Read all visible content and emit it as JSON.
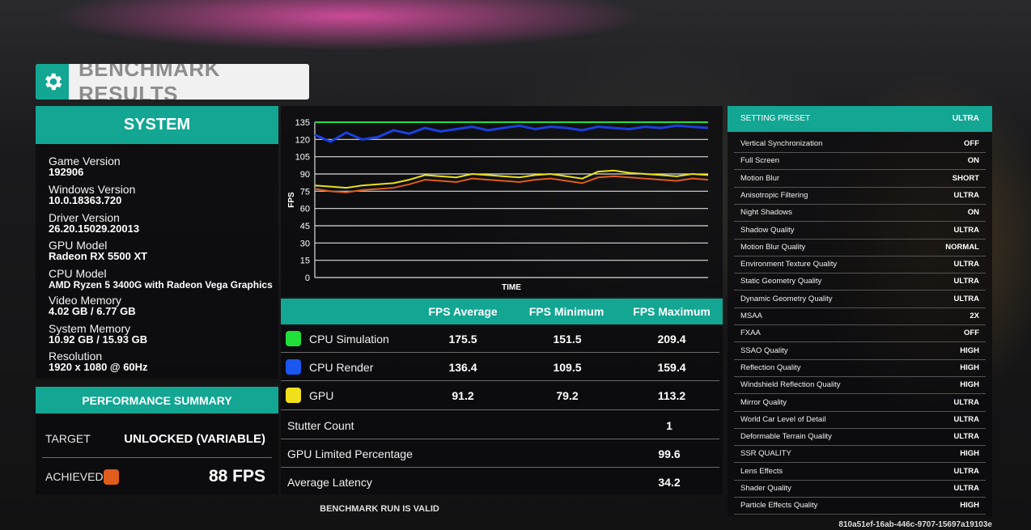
{
  "title": "BENCHMARK RESULTS",
  "icons": {
    "title": "gear-icon"
  },
  "system": {
    "heading": "SYSTEM",
    "items": [
      {
        "label": "Game Version",
        "value": "192906"
      },
      {
        "label": "Windows Version",
        "value": "10.0.18363.720"
      },
      {
        "label": "Driver Version",
        "value": "26.20.15029.20013"
      },
      {
        "label": "GPU Model",
        "value": "Radeon RX 5500 XT"
      },
      {
        "label": "CPU Model",
        "value": "AMD Ryzen 5 3400G with Radeon Vega Graphics"
      },
      {
        "label": "Video Memory",
        "value": "4.02 GB / 6.77 GB"
      },
      {
        "label": "System Memory",
        "value": "10.92 GB / 15.93 GB"
      },
      {
        "label": "Resolution",
        "value": "1920 x 1080 @ 60Hz"
      }
    ]
  },
  "performance": {
    "heading": "PERFORMANCE SUMMARY",
    "target_label": "TARGET",
    "target_value": "UNLOCKED (VARIABLE)",
    "achieved_label": "ACHIEVED",
    "achieved_value": "88 FPS",
    "achieved_color": "#e05c1c"
  },
  "chart_data": {
    "type": "line",
    "title": "",
    "xlabel": "TIME",
    "ylabel": "FPS",
    "ylim": [
      0,
      135
    ],
    "yticks": [
      0,
      15,
      30,
      45,
      60,
      75,
      90,
      105,
      120,
      135
    ],
    "grid": true,
    "x": [
      0,
      4,
      8,
      12,
      16,
      20,
      24,
      28,
      32,
      36,
      40,
      44,
      48,
      52,
      56,
      60,
      64,
      68,
      72,
      76,
      80,
      84,
      88,
      92,
      96,
      100
    ],
    "series": [
      {
        "color": "#22e03a",
        "values": [
          135,
          135,
          135,
          135,
          135,
          135,
          135,
          135,
          135,
          135,
          135,
          135,
          135,
          135,
          135,
          135,
          135,
          135,
          135,
          135,
          135,
          135,
          135,
          135,
          135,
          135
        ]
      },
      {
        "color": "#1a3fe0",
        "values": [
          124,
          118,
          126,
          120,
          122,
          128,
          125,
          130,
          127,
          129,
          131,
          128,
          130,
          132,
          129,
          131,
          130,
          128,
          131,
          130,
          129,
          131,
          130,
          132,
          131,
          130
        ]
      },
      {
        "color": "#e8e01c",
        "values": [
          80,
          79,
          78,
          80,
          81,
          82,
          85,
          89,
          88,
          87,
          90,
          89,
          88,
          87,
          89,
          90,
          88,
          86,
          92,
          93,
          91,
          90,
          89,
          88,
          90,
          89
        ]
      },
      {
        "color": "#e05c1c",
        "values": [
          77,
          75,
          74,
          76,
          77,
          78,
          81,
          85,
          84,
          83,
          86,
          85,
          84,
          83,
          85,
          86,
          84,
          82,
          87,
          88,
          87,
          86,
          85,
          84,
          86,
          85
        ]
      }
    ]
  },
  "table": {
    "headers": [
      "FPS Average",
      "FPS Minimum",
      "FPS Maximum"
    ],
    "rows": [
      {
        "label": "CPU Simulation",
        "color": "#22e03a",
        "values": [
          "175.5",
          "151.5",
          "209.4"
        ]
      },
      {
        "label": "CPU Render",
        "color": "#1a56f0",
        "values": [
          "136.4",
          "109.5",
          "159.4"
        ]
      },
      {
        "label": "GPU",
        "color": "#f0e01c",
        "values": [
          "91.2",
          "79.2",
          "113.2"
        ]
      }
    ],
    "stats": [
      {
        "label": "Stutter Count",
        "value": "1"
      },
      {
        "label": "GPU Limited Percentage",
        "value": "99.6"
      },
      {
        "label": "Average Latency",
        "value": "34.2"
      }
    ],
    "valid_text": "BENCHMARK RUN IS VALID"
  },
  "settings": {
    "preset_label": "SETTING PRESET",
    "preset_value": "ULTRA",
    "items": [
      {
        "label": "Vertical Synchronization",
        "value": "OFF"
      },
      {
        "label": "Full Screen",
        "value": "ON"
      },
      {
        "label": "Motion Blur",
        "value": "SHORT"
      },
      {
        "label": "Anisotropic Filtering",
        "value": "ULTRA"
      },
      {
        "label": "Night Shadows",
        "value": "ON"
      },
      {
        "label": "Shadow Quality",
        "value": "ULTRA"
      },
      {
        "label": "Motion Blur Quality",
        "value": "NORMAL"
      },
      {
        "label": "Environment Texture Quality",
        "value": "ULTRA"
      },
      {
        "label": "Static Geometry Quality",
        "value": "ULTRA"
      },
      {
        "label": "Dynamic Geometry Quality",
        "value": "ULTRA"
      },
      {
        "label": "MSAA",
        "value": "2X"
      },
      {
        "label": "FXAA",
        "value": "OFF"
      },
      {
        "label": "SSAO Quality",
        "value": "HIGH"
      },
      {
        "label": "Reflection Quality",
        "value": "HIGH"
      },
      {
        "label": "Windshield Reflection Quality",
        "value": "HIGH"
      },
      {
        "label": "Mirror Quality",
        "value": "ULTRA"
      },
      {
        "label": "World Car Level of Detail",
        "value": "ULTRA"
      },
      {
        "label": "Deformable Terrain Quality",
        "value": "ULTRA"
      },
      {
        "label": "SSR QUALITY",
        "value": "HIGH"
      },
      {
        "label": "Lens Effects",
        "value": "ULTRA"
      },
      {
        "label": "Shader Quality",
        "value": "ULTRA"
      },
      {
        "label": "Particle Effects Quality",
        "value": "HIGH"
      }
    ]
  },
  "run_id": "810a51ef-16ab-446c-9707-15697a19103e"
}
